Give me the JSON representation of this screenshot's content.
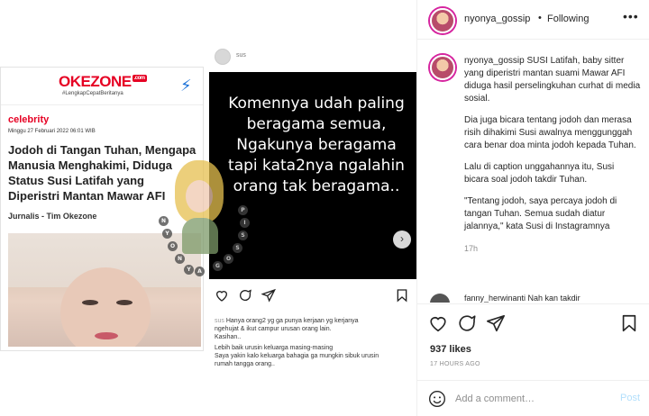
{
  "colors": {
    "story_ring": "#d6249f",
    "okezone_red": "#e60023",
    "post_button": "#b2dffc"
  },
  "article": {
    "logo": "OKEZONE",
    "logo_suffix": ".com",
    "tagline": "#LengkapCepatBeritanya",
    "category": "celebrity",
    "date": "Minggu 27 Februari 2022 06:01 WIB",
    "headline": "Jodoh di Tangan Tuhan, Mengapa Manusia Menghakimi, Diduga Status Susi Latifah yang Diperistri Mantan Mawar AFI",
    "byline": "Jurnalis - Tim Okezone"
  },
  "screenshot": {
    "username": "sus",
    "black_text": "Komennya udah paling beragama semua, Ngakunya beragama tapi kata2nya ngalahin orang tak beragama..",
    "caption_user": "sus",
    "caption_lines": [
      "Hanya orang2 yg ga punya kerjaan yg kerjanya",
      "ngehujat & ikut campur urusan orang lain.",
      "Kasihan..",
      "Lebih baik urusin keluarga masing-masing",
      "Saya yakin kalo keluarga  bahagia ga mungkin sibuk urusin",
      "rumah tangga orang.."
    ]
  },
  "watermark": {
    "letters": [
      "N",
      "Y",
      "O",
      "N",
      "Y",
      "A",
      "G",
      "O",
      "S",
      "S",
      "I",
      "P"
    ]
  },
  "sidebar": {
    "header": {
      "username": "nyonya_gossip",
      "dot": "•",
      "follow_label": "Following",
      "more": "•••"
    },
    "caption": {
      "username": "nyonya_gossip",
      "p1": "SUSI Latifah, baby sitter yang diperistri mantan suami Mawar AFI diduga hasil perselingkuhan curhat di media sosial.",
      "p2": "Dia juga bicara tentang jodoh dan merasa risih dihakimi Susi awalnya menggunggah cara benar doa minta jodoh kepada Tuhan.",
      "p3": "Lalu di caption unggahannya itu, Susi bicara soal jodoh takdir Tuhan.",
      "p4": "\"Tentang jodoh, saya percaya jodoh di tangan Tuhan. Semua sudah diatur jalannya,\" kata Susi di Instagramnya",
      "time": "17h"
    },
    "next_comment": "fanny_herwinanti Nah kan takdir",
    "likes": "937 likes",
    "age": "17 HOURS AGO",
    "comment_placeholder": "Add a comment…",
    "post_label": "Post"
  }
}
